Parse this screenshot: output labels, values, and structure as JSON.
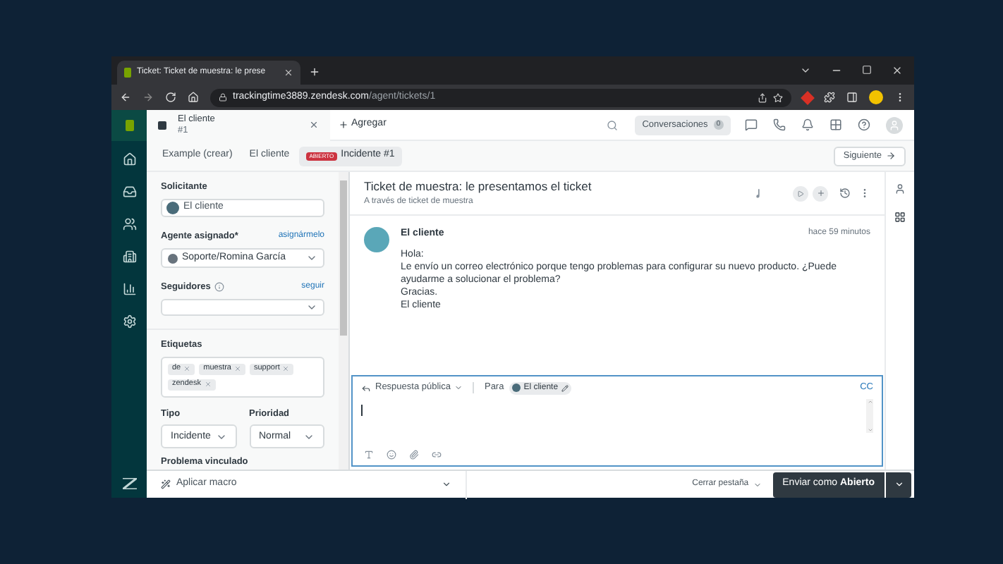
{
  "browser": {
    "tab_title": "Ticket: Ticket de muestra: le prese",
    "url_host": "trackingtime3889.zendesk.com",
    "url_path": "/agent/tickets/1"
  },
  "topbar": {
    "ticket_tab": {
      "title": "El cliente",
      "subtitle": "#1"
    },
    "add": "Agregar",
    "conversations": {
      "label": "Conversaciones",
      "count": "0"
    }
  },
  "ticket_tabs": [
    {
      "label": "Example (crear)",
      "selected": false
    },
    {
      "label": "El cliente",
      "selected": false
    },
    {
      "badge": "ABIERTO",
      "label": "Incidente #1",
      "selected": true
    }
  ],
  "next_button": "Siguiente",
  "properties": {
    "requester": {
      "label": "Solicitante",
      "value": "El cliente"
    },
    "assignee": {
      "label": "Agente asignado*",
      "link": "asignármelo",
      "value": "Soporte/Romina García"
    },
    "followers": {
      "label": "Seguidores",
      "link": "seguir"
    },
    "tags": {
      "label": "Etiquetas",
      "items": [
        "de",
        "muestra",
        "support",
        "zendesk"
      ]
    },
    "type": {
      "label": "Tipo",
      "value": "Incidente"
    },
    "priority": {
      "label": "Prioridad",
      "value": "Normal"
    },
    "linked_problem": {
      "label": "Problema vinculado"
    }
  },
  "ticket": {
    "title": "Ticket de muestra: le presentamos el ticket",
    "via": "A través de ticket de muestra",
    "message": {
      "author": "El cliente",
      "time": "hace 59 minutos",
      "lines": [
        "Hola:",
        "Le envío un correo electrónico porque tengo problemas para configurar su nuevo producto. ¿Puede ayudarme a solucionar el problema?",
        "Gracias.",
        "El cliente"
      ]
    }
  },
  "composer": {
    "mode": "Respuesta pública",
    "to_label": "Para",
    "recipient": "El cliente",
    "cc": "CC"
  },
  "footer": {
    "macro": "Aplicar macro",
    "close_tab": "Cerrar pestaña",
    "submit": "Enviar como **Abierto**"
  }
}
